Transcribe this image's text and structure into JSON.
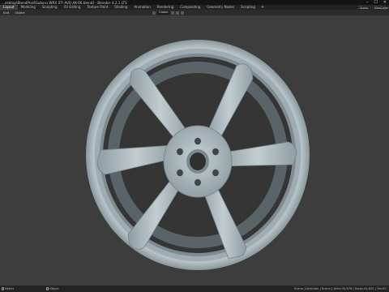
{
  "window": {
    "title": "...esktop\\BlendProd\\Subaru WRX STI AVO AK-06.blend] - Blender 4.2.1 LTS"
  },
  "workspaces": [
    "Layout",
    "Modeling",
    "Sculpting",
    "UV Editing",
    "Texture Paint",
    "Shading",
    "Animation",
    "Rendering",
    "Compositing",
    "Geometry Nodes",
    "Scripting"
  ],
  "active_workspace": "Layout",
  "scene": {
    "name": "Scene",
    "view_layer": "ViewLayer"
  },
  "header": {
    "view_label": "Edit",
    "object_label": "Object",
    "orientation": "Global"
  },
  "status": {
    "select_label": "Select",
    "move_label": "Move",
    "rotate_label": "Object",
    "stats": "Scene_Collection | Scene | Verts:35,678 | Faces:43,820 | Tris:87,"
  },
  "icons": {
    "add": "plus-icon",
    "minimize": "minimize-icon",
    "maximize": "maximize-icon",
    "close": "close-icon"
  },
  "colors": {
    "wheel": "#a7b5bb",
    "viewport_bg": "#3d3d3d",
    "active_tab": "#3f3f3f"
  }
}
